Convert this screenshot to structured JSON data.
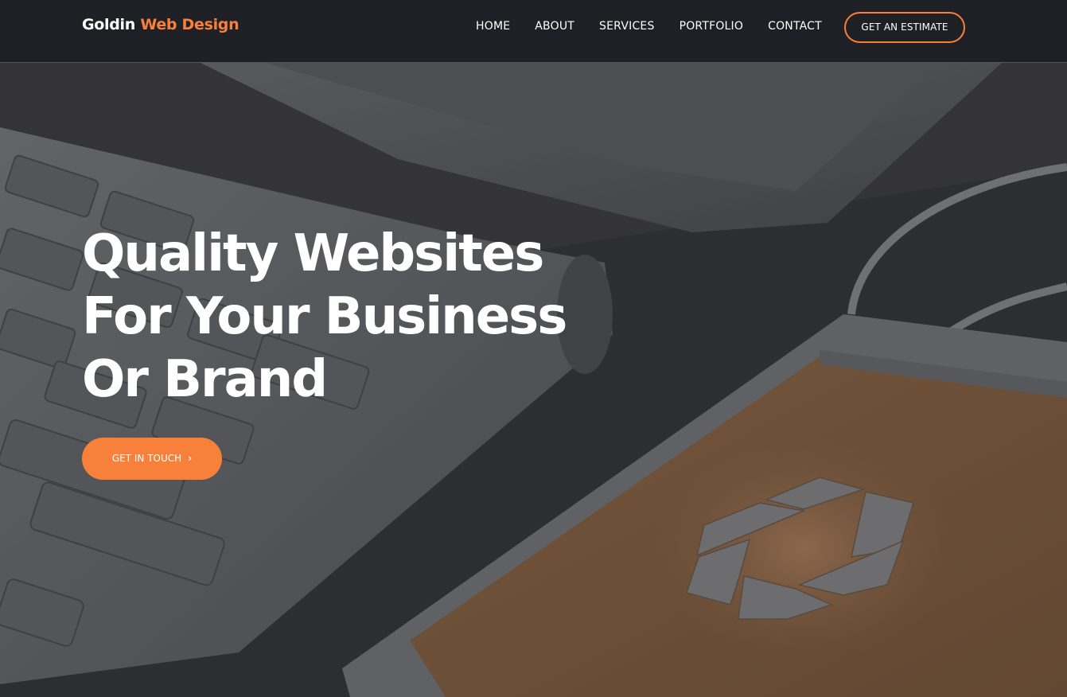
{
  "brand": {
    "name_part1": "Goldin",
    "name_part2": "Web Design",
    "accent_color": "#f7813a"
  },
  "nav": {
    "items": [
      {
        "label": "HOME"
      },
      {
        "label": "ABOUT"
      },
      {
        "label": "SERVICES"
      },
      {
        "label": "PORTFOLIO"
      },
      {
        "label": "CONTACT"
      }
    ],
    "estimate_label": "GET AN ESTIMATE"
  },
  "hero": {
    "headline_lines": [
      "Quality Websites",
      "For Your Business",
      "Or Brand"
    ],
    "cta_label": "GET IN TOUCH",
    "cta_icon": "chevron-right-icon",
    "background_image": "keyboard-and-phone-photo"
  }
}
